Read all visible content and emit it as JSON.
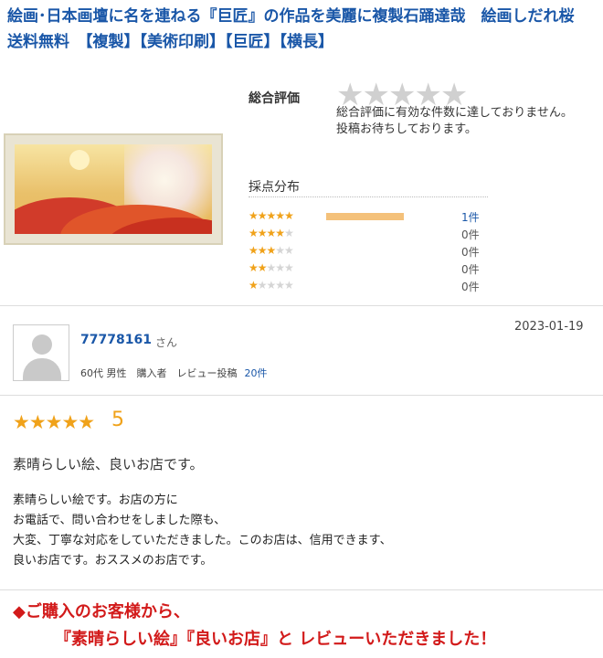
{
  "product": {
    "title": "絵画･日本画壇に名を連ねる『巨匠』の作品を美麗に複製石踊達哉　絵画しだれ桜　送料無料　【複製】【美術印刷】【巨匠】【横長】"
  },
  "summary": {
    "overall_label": "総合評価",
    "overall_note_line1": "総合評価に有効な件数に達しておりません。",
    "overall_note_line2": "投稿お待ちしております。",
    "distribution_label": "採点分布",
    "rows": [
      {
        "stars": 5,
        "count": "1件",
        "ratio": 1.0
      },
      {
        "stars": 4,
        "count": "0件",
        "ratio": 0
      },
      {
        "stars": 3,
        "count": "0件",
        "ratio": 0
      },
      {
        "stars": 2,
        "count": "0件",
        "ratio": 0
      },
      {
        "stars": 1,
        "count": "0件",
        "ratio": 0
      }
    ]
  },
  "review": {
    "username": "77778161",
    "san": "さん",
    "meta": "60代 男性　購入者　レビュー投稿",
    "review_count": "20件",
    "date": "2023-01-19",
    "rating": "5",
    "title": "素晴らしい絵、良いお店です。",
    "body": [
      "素晴らしい絵です。お店の方に",
      "お電話で、問い合わせをしました際も、",
      "大変、丁寧な対応をしていただきました。このお店は、信用できます、",
      "良いお店です。おススメのお店です。"
    ]
  },
  "promo": {
    "line1": "◆ご購入のお客様から、",
    "line2": "『素晴らしい絵』『良いお店』と レビューいただきました！"
  },
  "colors": {
    "accent_blue": "#1a57a8",
    "star_orange": "#f0a21a",
    "promo_red": "#d21a1a"
  }
}
